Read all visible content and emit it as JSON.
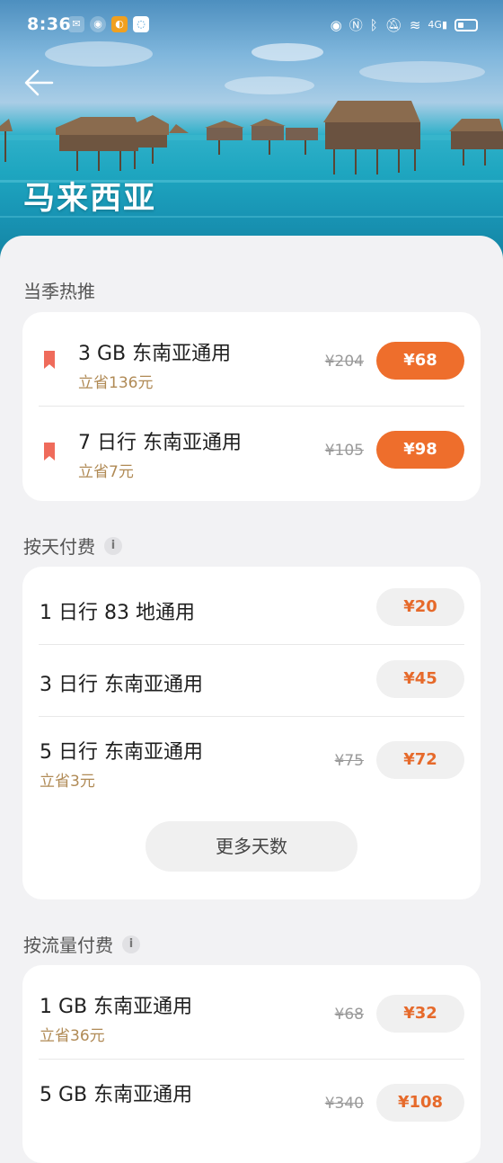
{
  "status_bar": {
    "time": "8:36",
    "network": "4G"
  },
  "header": {
    "title": "马来西亚"
  },
  "sections": [
    {
      "title": "当季热推",
      "has_info": false,
      "items": [
        {
          "name": "3 GB 东南亚通用",
          "saving": "立省136元",
          "original_price": "¥204",
          "price": "¥68"
        },
        {
          "name": "7 日行 东南亚通用",
          "saving": "立省7元",
          "original_price": "¥105",
          "price": "¥98"
        }
      ]
    },
    {
      "title": "按天付费",
      "has_info": true,
      "items": [
        {
          "name": "1 日行  83 地通用",
          "saving": "",
          "original_price": "",
          "price": "¥20"
        },
        {
          "name": "3 日行 东南亚通用",
          "saving": "",
          "original_price": "",
          "price": "¥45"
        },
        {
          "name": "5 日行 东南亚通用",
          "saving": "立省3元",
          "original_price": "¥75",
          "price": "¥72"
        }
      ],
      "more_label": "更多天数"
    },
    {
      "title": "按流量付费",
      "has_info": true,
      "items": [
        {
          "name": "1 GB 东南亚通用",
          "saving": "立省36元",
          "original_price": "¥68",
          "price": "¥32"
        },
        {
          "name": "5 GB 东南亚通用",
          "saving": "",
          "original_price": "¥340",
          "price": "¥108"
        }
      ]
    }
  ],
  "colors": {
    "accent": "#ee6e2c",
    "saving_text": "#b08a55",
    "bookmark": "#ef6b5b"
  },
  "icons": {
    "info": "i"
  }
}
